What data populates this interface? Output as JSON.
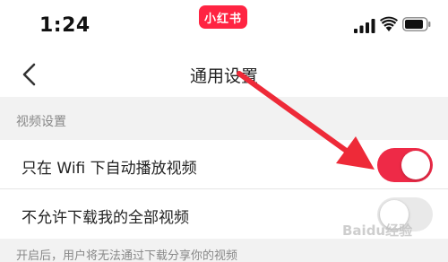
{
  "status_bar": {
    "time": "1:24",
    "app_badge": "小红书",
    "badge_color": "#ff2442",
    "icons": [
      "signal-icon",
      "wifi-icon",
      "battery-icon"
    ]
  },
  "nav": {
    "title": "通用设置",
    "back_icon": "chevron-left-icon"
  },
  "video_settings": {
    "section_title": "视频设置",
    "items": [
      {
        "label": "只在 Wifi 下自动播放视频",
        "enabled": true
      },
      {
        "label": "不允许下载我的全部视频",
        "enabled": false
      }
    ],
    "footer_note": "开启后，用户将无法通过下载分享你的视频"
  },
  "accent_color": "#ee2a47",
  "watermark": "Baidu经验"
}
